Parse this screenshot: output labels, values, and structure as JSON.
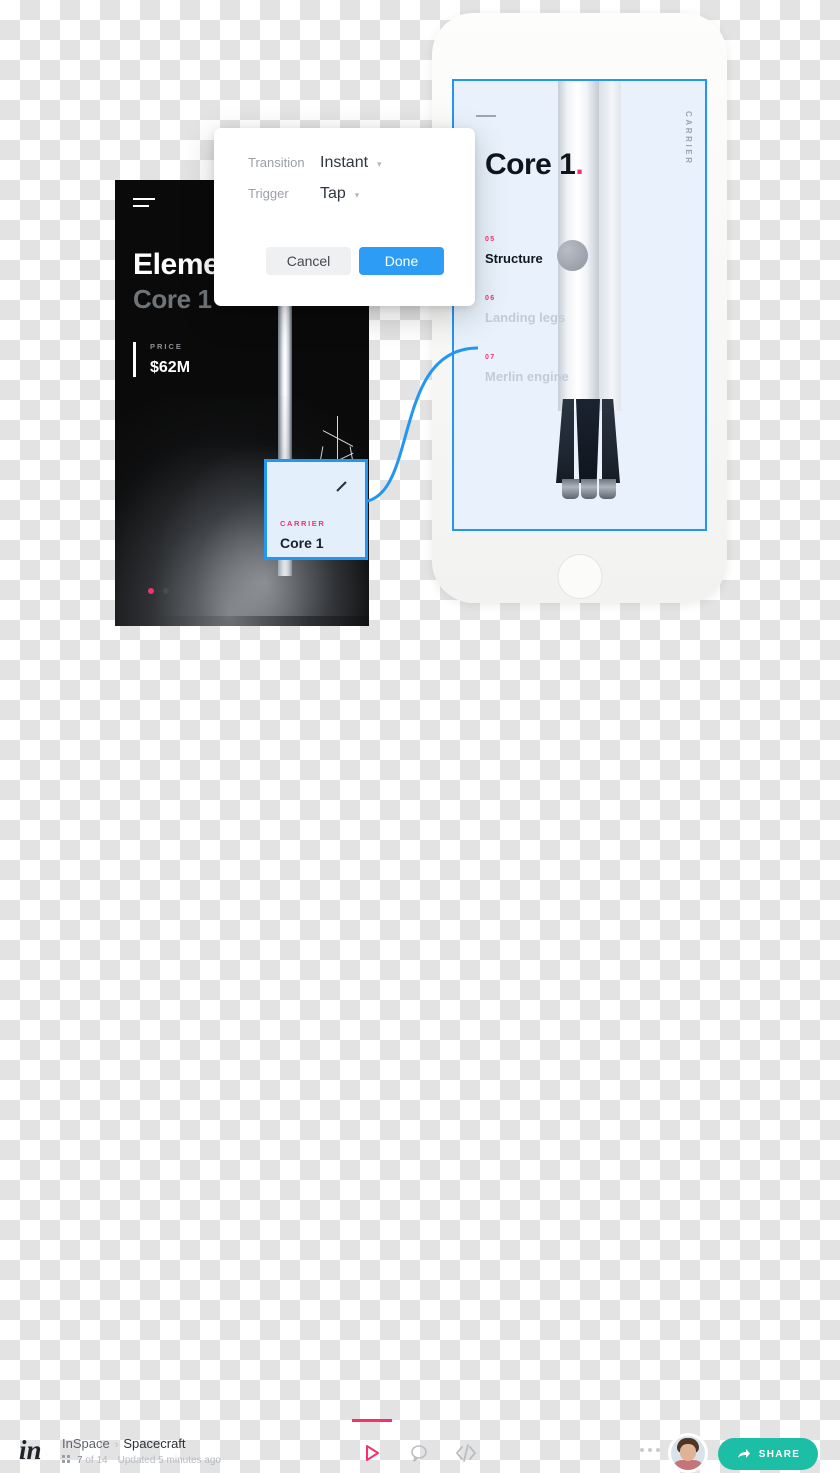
{
  "modal": {
    "transition_label": "Transition",
    "transition_value": "Instant",
    "trigger_label": "Trigger",
    "trigger_value": "Tap",
    "caret": "▾",
    "cancel_label": "Cancel",
    "done_label": "Done",
    "done_color": "#2d9cf5"
  },
  "dark_card": {
    "title": "Elements",
    "subtitle": "Core 1",
    "price_label": "PRICE",
    "price_value": "$62M",
    "dots": [
      "active",
      "inactive"
    ]
  },
  "hotspot": {
    "eyebrow": "CARRIER",
    "name": "Core 1",
    "border_color": "#2196f3",
    "accent_color": "#f5326a"
  },
  "phone_screen": {
    "title": "Core 1",
    "title_dot": ".",
    "side_label": "CARRIER",
    "items": [
      {
        "num": "05",
        "name": "Structure",
        "state": "active"
      },
      {
        "num": "06",
        "name": "Landing legs",
        "state": "inactive"
      },
      {
        "num": "07",
        "name": "Merlin engine",
        "state": "inactive"
      }
    ]
  },
  "bottom_bar": {
    "logo": "in",
    "breadcrumb_root": "InSpace",
    "breadcrumb_sep": "›",
    "breadcrumb_current": "Spacecraft",
    "screen_count": "7",
    "screen_count_total": "of 14",
    "updated": "Updated 5 minutes ago",
    "share_label": "SHARE",
    "share_color": "#1cbfa5",
    "play_color": "#f5326a"
  }
}
